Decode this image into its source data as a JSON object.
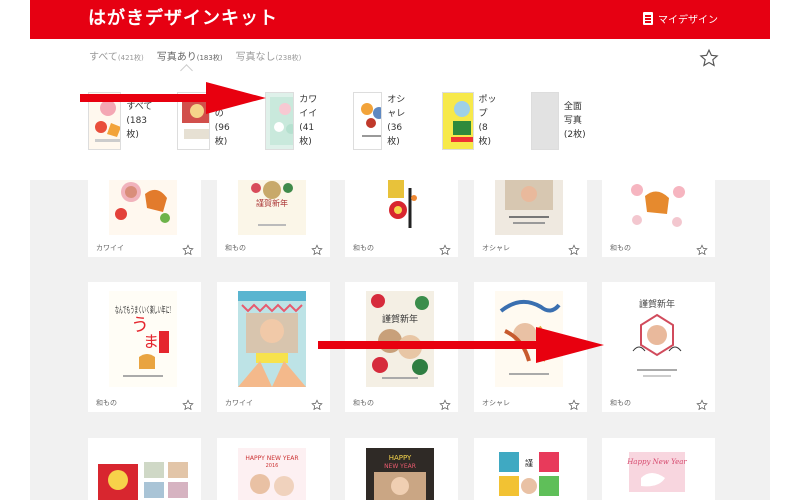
{
  "header": {
    "logo": "はがきデザインキット",
    "my_design": "マイデザイン",
    "accent": "#e60012"
  },
  "filters": [
    {
      "label": "すべて",
      "count": "(421枚)"
    },
    {
      "label": "写真あり",
      "count": "(183枚)"
    },
    {
      "label": "写真なし",
      "count": "(238枚)"
    }
  ],
  "categories": [
    {
      "name": "すべて",
      "count": "(183枚)"
    },
    {
      "name": "和もの",
      "count": "(96枚)"
    },
    {
      "name": "カワイイ",
      "count": "(41枚)"
    },
    {
      "name": "オシャレ",
      "count": "(36枚)"
    },
    {
      "name": "ポップ",
      "count": "(8枚)"
    },
    {
      "name": "全面写真",
      "count": "(2枚)"
    }
  ],
  "cards": [
    {
      "label": "カワイイ"
    },
    {
      "label": "和もの"
    },
    {
      "label": "和もの"
    },
    {
      "label": "オシャレ"
    },
    {
      "label": "和もの"
    },
    {
      "label": "和もの"
    },
    {
      "label": "カワイイ"
    },
    {
      "label": "和もの"
    },
    {
      "label": "オシャレ"
    },
    {
      "label": "和もの"
    },
    {
      "label": ""
    },
    {
      "label": ""
    },
    {
      "label": ""
    },
    {
      "label": ""
    },
    {
      "label": ""
    }
  ],
  "card_texts": {
    "gashin": "謹賀新年",
    "nandemo": "なんでもうまくいく楽しい年に!",
    "happy_new_year": "HAPPY NEW YEAR",
    "year": "2016",
    "happy": "HAPPY",
    "newyear_script": "Happy New Year"
  },
  "annotation_color": "#e8000f"
}
